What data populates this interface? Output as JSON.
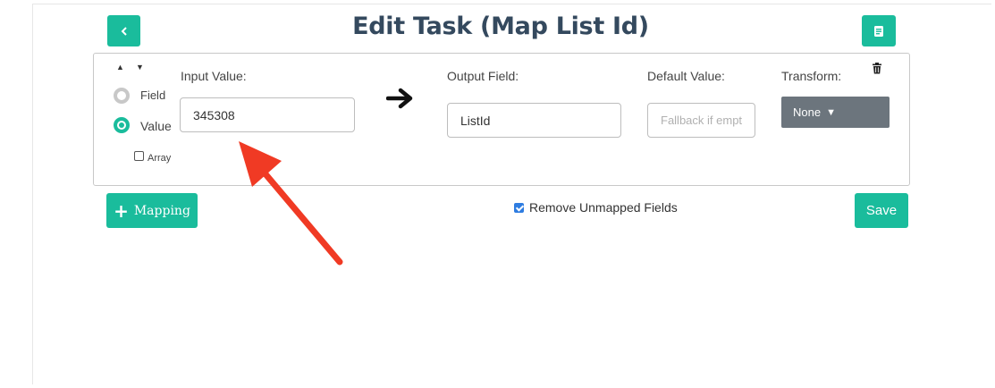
{
  "header": {
    "title": "Edit Task (Map List Id)",
    "back_icon": "chevron-left-icon",
    "doc_icon": "document-icon"
  },
  "mapping": {
    "input_label": "Input Value:",
    "input_value": "345308",
    "source_options": [
      {
        "label": "Field",
        "selected": false
      },
      {
        "label": "Value",
        "selected": true
      }
    ],
    "array_label": "Array",
    "array_checked": false,
    "output_label": "Output Field:",
    "output_value": "ListId",
    "default_label": "Default Value:",
    "default_placeholder": "Fallback if empty",
    "transform_label": "Transform:",
    "transform_value": "None"
  },
  "footer": {
    "add_mapping_label": "Mapping",
    "remove_unmapped_label": "Remove Unmapped Fields",
    "remove_unmapped_checked": true,
    "save_label": "Save"
  },
  "colors": {
    "accent": "#1abc9c",
    "title": "#34495e",
    "transform_bg": "#6c757d",
    "annotation_arrow": "#f03a24"
  }
}
